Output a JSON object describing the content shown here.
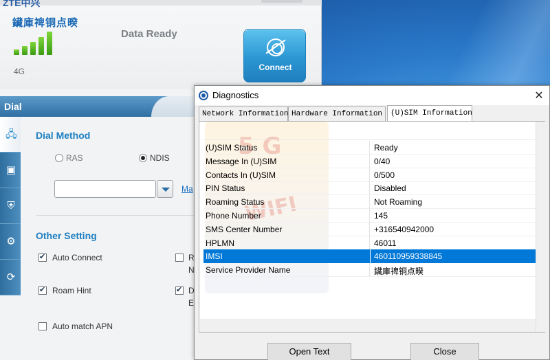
{
  "app": {
    "logo_fragment": "ZTE中兴",
    "operator": "鑶庫禆铜点暌",
    "network_type": "4G",
    "status": "Data Ready",
    "connect_label": "Connect",
    "signal_bars": 5
  },
  "dial": {
    "header": "Dial",
    "dial_method_title": "Dial Method",
    "radio_ras": "RAS",
    "radio_ndis": "NDIS",
    "selected_method": "NDIS",
    "manage_link": "Ma",
    "combo_value": "",
    "other_setting_title": "Other Setting",
    "auto_connect": "Auto Connect",
    "roam_hint": "Roam Hint",
    "auto_match_apn": "Auto match APN",
    "right_col_1a": "R",
    "right_col_1b": "N",
    "right_col_2a": "D",
    "right_col_2b": "E"
  },
  "diagnostics": {
    "title": "Diagnostics",
    "close_glyph": "✕",
    "tabs": [
      "Network Information",
      "Hardware Information",
      "(U)SIM Information"
    ],
    "active_tab": "(U)SIM Information",
    "rows": [
      {
        "key": "(U)SIM Status",
        "value": "Ready"
      },
      {
        "key": "Message In (U)SIM",
        "value": "0/40"
      },
      {
        "key": "Contacts In (U)SIM",
        "value": "0/500"
      },
      {
        "key": "PIN Status",
        "value": "Disabled"
      },
      {
        "key": "Roaming Status",
        "value": "Not Roaming"
      },
      {
        "key": "Phone Number",
        "value": "145"
      },
      {
        "key": "SMS Center Number",
        "value": "+316540942000"
      },
      {
        "key": "HPLMN",
        "value": "46011"
      },
      {
        "key": "IMSI",
        "value": "460110959338845"
      },
      {
        "key": "Service Provider Name",
        "value": "鑶庫禆铜点暌"
      }
    ],
    "selected_row": "IMSI",
    "open_text_label": "Open Text",
    "close_label": "Close",
    "watermark_top": "5 G",
    "watermark_bottom": "WIFI"
  },
  "colors": {
    "accent_blue": "#1c7fc1",
    "selection": "#0078d7",
    "connect_button": "#2b96d3",
    "signal_green": "#5ab825"
  }
}
